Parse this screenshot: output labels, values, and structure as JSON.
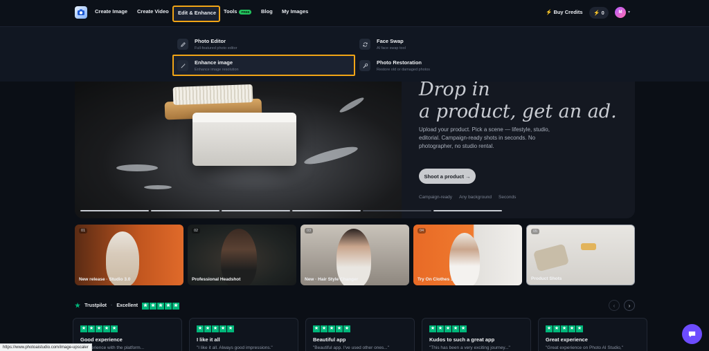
{
  "nav": {
    "items": [
      {
        "label": "Create Image"
      },
      {
        "label": "Create Video"
      },
      {
        "label": "Edit & Enhance"
      },
      {
        "label": "Tools",
        "badge": "FREE"
      },
      {
        "label": "Blog"
      },
      {
        "label": "My Images"
      }
    ],
    "buy_credits": "Buy Credits",
    "credits": "0",
    "avatar_initial": "M"
  },
  "dropdown": {
    "items": [
      {
        "title": "Photo Editor",
        "subtitle": "Full-featured photo editor",
        "icon": "edit-icon"
      },
      {
        "title": "Enhance image",
        "subtitle": "Enhance image resolution",
        "icon": "magic-wand-icon"
      },
      {
        "title": "Face Swap",
        "subtitle": "AI face swap tool",
        "icon": "swap-icon"
      },
      {
        "title": "Photo Restoration",
        "subtitle": "Restore old or damaged photos",
        "icon": "wrench-icon"
      }
    ]
  },
  "hero": {
    "title_line1": "Drop in",
    "title_line2": "a product, get an ad.",
    "description": "Upload your product. Pick a scene — lifestyle, studio, editorial. Campaign-ready shots in seconds. No photographer, no studio rental.",
    "cta": "Shoot a product →",
    "tags": [
      "Campaign-ready",
      "Any background",
      "Seconds"
    ]
  },
  "thumbnails": [
    {
      "num": "01",
      "caption": "New release · Studio 3.0"
    },
    {
      "num": "02",
      "caption": "Professional Headshot"
    },
    {
      "num": "03",
      "caption": "New · Hair Style Changer"
    },
    {
      "num": "04",
      "caption": "Try On Clothes 3.0"
    },
    {
      "num": "05",
      "caption": "Product Shots"
    }
  ],
  "trustpilot": {
    "brand": "Trustpilot",
    "rating_label": "Excellent"
  },
  "reviews": [
    {
      "title": "Good experience",
      "body": "...experience with the platform..."
    },
    {
      "title": "I like it all",
      "body": "\"I like it all. Always good impressions.\""
    },
    {
      "title": "Beautiful app",
      "body": "\"Beautiful app. I've used other ones...\""
    },
    {
      "title": "Kudos to such a great app",
      "body": "\"This has been a very exciting journey...\""
    },
    {
      "title": "Great experience",
      "body": "\"Great experience on Photo AI Studio,\""
    }
  ],
  "status_url": "https://www.photoaistudio.com/image-upscaler",
  "colors": {
    "highlight": "#f2a516",
    "trustpilot_green": "#00b67a",
    "chat_purple": "#6d4cff"
  }
}
